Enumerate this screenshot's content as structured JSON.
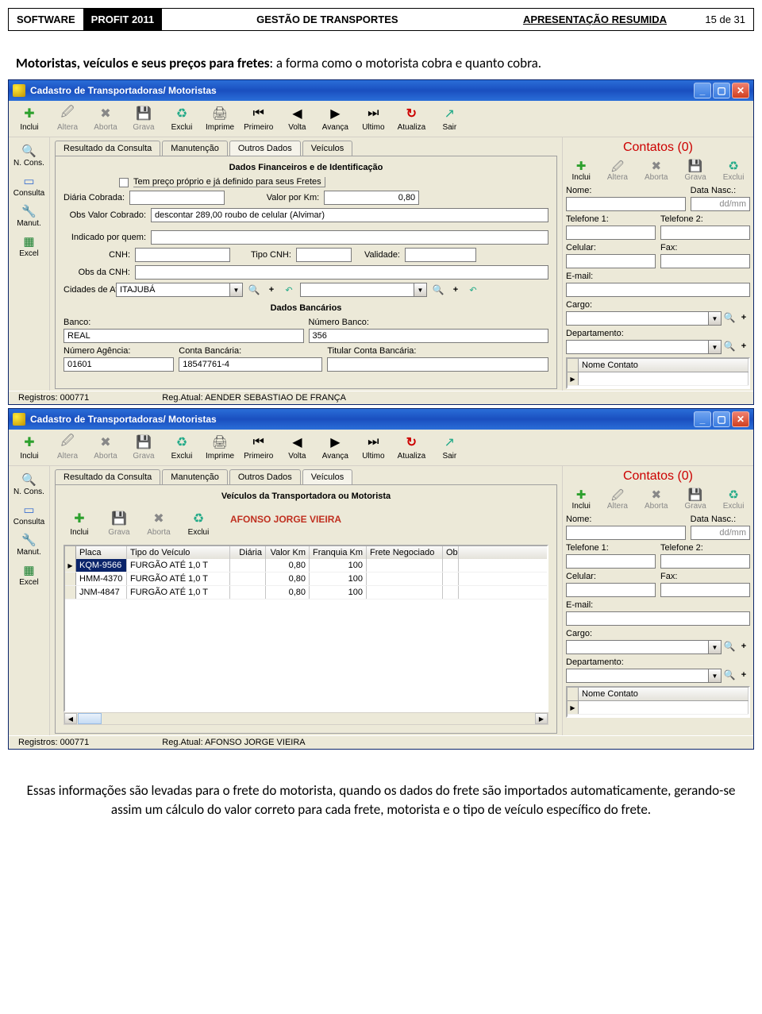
{
  "doc": {
    "software": "SOFTWARE",
    "profit": "PROFIT 2011",
    "mid": "GESTÃO DE TRANSPORTES",
    "right": "APRESENTAÇÃO RESUMIDA",
    "page": "15 de 31",
    "caption_bold": "Motoristas, veículos e seus preços para fretes",
    "caption_rest": ": a forma como o motorista cobra e quanto cobra.",
    "footer1": "Essas informações são levadas para o frete do motorista, quando os dados do frete são importados automaticamente, gerando-se assim um cálculo do valor correto para cada frete, motorista e o tipo de veículo específico do frete."
  },
  "toolbar": {
    "inclui": "Inclui",
    "altera": "Altera",
    "aborta": "Aborta",
    "grava": "Grava",
    "exclui": "Exclui",
    "imprime": "Imprime",
    "primeiro": "Primeiro",
    "volta": "Volta",
    "avanca": "Avança",
    "ultimo": "Ultimo",
    "atualiza": "Atualiza",
    "sair": "Sair"
  },
  "sidebar": {
    "ncons": "N. Cons.",
    "consulta": "Consulta",
    "manut": "Manut.",
    "excel": "Excel"
  },
  "win1": {
    "title": "Cadastro de Transportadoras/ Motoristas",
    "tabs": [
      "Resultado da Consulta",
      "Manutenção",
      "Outros Dados",
      "Veículos"
    ],
    "active_tab": 2,
    "group1": "Dados Financeiros e de Identificação",
    "chk_label": "Tem preço próprio e já definido para seus Fretes",
    "diaria_lbl": "Diária Cobrada:",
    "diaria_val": "",
    "valor_km_lbl": "Valor por Km:",
    "valor_km_val": "0,80",
    "obs_val_lbl": "Obs Valor Cobrado:",
    "obs_val": "descontar 289,00 roubo de celular (Alvimar)",
    "indicado_lbl": "Indicado por quem:",
    "indicado": "",
    "cnh_lbl": "CNH:",
    "cnh": "",
    "tipo_cnh_lbl": "Tipo CNH:",
    "tipo_cnh": "",
    "validade_lbl": "Validade:",
    "validade": "",
    "obs_cnh_lbl": "Obs da CNH:",
    "obs_cnh": "",
    "cidades_lbl": "Cidades de Atuação:",
    "cidade1": "ITAJUBÁ",
    "cidade2": "",
    "group2": "Dados Bancários",
    "banco_lbl": "Banco:",
    "banco": "REAL",
    "numero_banco_lbl": "Número Banco:",
    "numero_banco": "356",
    "num_ag_lbl": "Número Agência:",
    "num_ag": "01601",
    "conta_lbl": "Conta Bancária:",
    "conta": "18547761-4",
    "titular_lbl": "Titular Conta Bancária:",
    "titular": "",
    "status_reg": "Registros: 000771",
    "status_atual": "Reg.Atual: AENDER SEBASTIAO DE FRANÇA"
  },
  "win2": {
    "title": "Cadastro de Transportadoras/ Motoristas",
    "tabs": [
      "Resultado da Consulta",
      "Manutenção",
      "Outros Dados",
      "Veículos"
    ],
    "active_tab": 3,
    "group1": "Veículos da Transportadora ou Motorista",
    "owner": "AFONSO JORGE VIEIRA",
    "cols": [
      "Placa",
      "Tipo do Veículo",
      "Diária",
      "Valor Km",
      "Franquia Km",
      "Frete Negociado",
      "Ob"
    ],
    "rows": [
      {
        "placa": "KQM-9566",
        "tipo": "FURGÃO ATÉ 1,0 T",
        "diaria": "",
        "valor": "0,80",
        "franquia": "100",
        "frete": "",
        "ob": ""
      },
      {
        "placa": "HMM-4370",
        "tipo": "FURGÃO ATÉ 1,0 T",
        "diaria": "",
        "valor": "0,80",
        "franquia": "100",
        "frete": "",
        "ob": ""
      },
      {
        "placa": "JNM-4847",
        "tipo": "FURGÃO ATÉ 1,0 T",
        "diaria": "",
        "valor": "0,80",
        "franquia": "100",
        "frete": "",
        "ob": ""
      }
    ],
    "status_reg": "Registros: 000771",
    "status_atual": "Reg.Atual: AFONSO JORGE VIEIRA"
  },
  "contacts": {
    "title": "Contatos (0)",
    "nome_lbl": "Nome:",
    "data_lbl": "Data Nasc.:",
    "data_ph": "dd/mm",
    "tel1_lbl": "Telefone 1:",
    "tel2_lbl": "Telefone 2:",
    "cel_lbl": "Celular:",
    "fax_lbl": "Fax:",
    "email_lbl": "E-mail:",
    "cargo_lbl": "Cargo:",
    "depto_lbl": "Departamento:",
    "grid_col": "Nome Contato"
  },
  "ctoolbar": {
    "inclui": "Inclui",
    "altera": "Altera",
    "aborta": "Aborta",
    "grava": "Grava",
    "exclui": "Exclui"
  }
}
